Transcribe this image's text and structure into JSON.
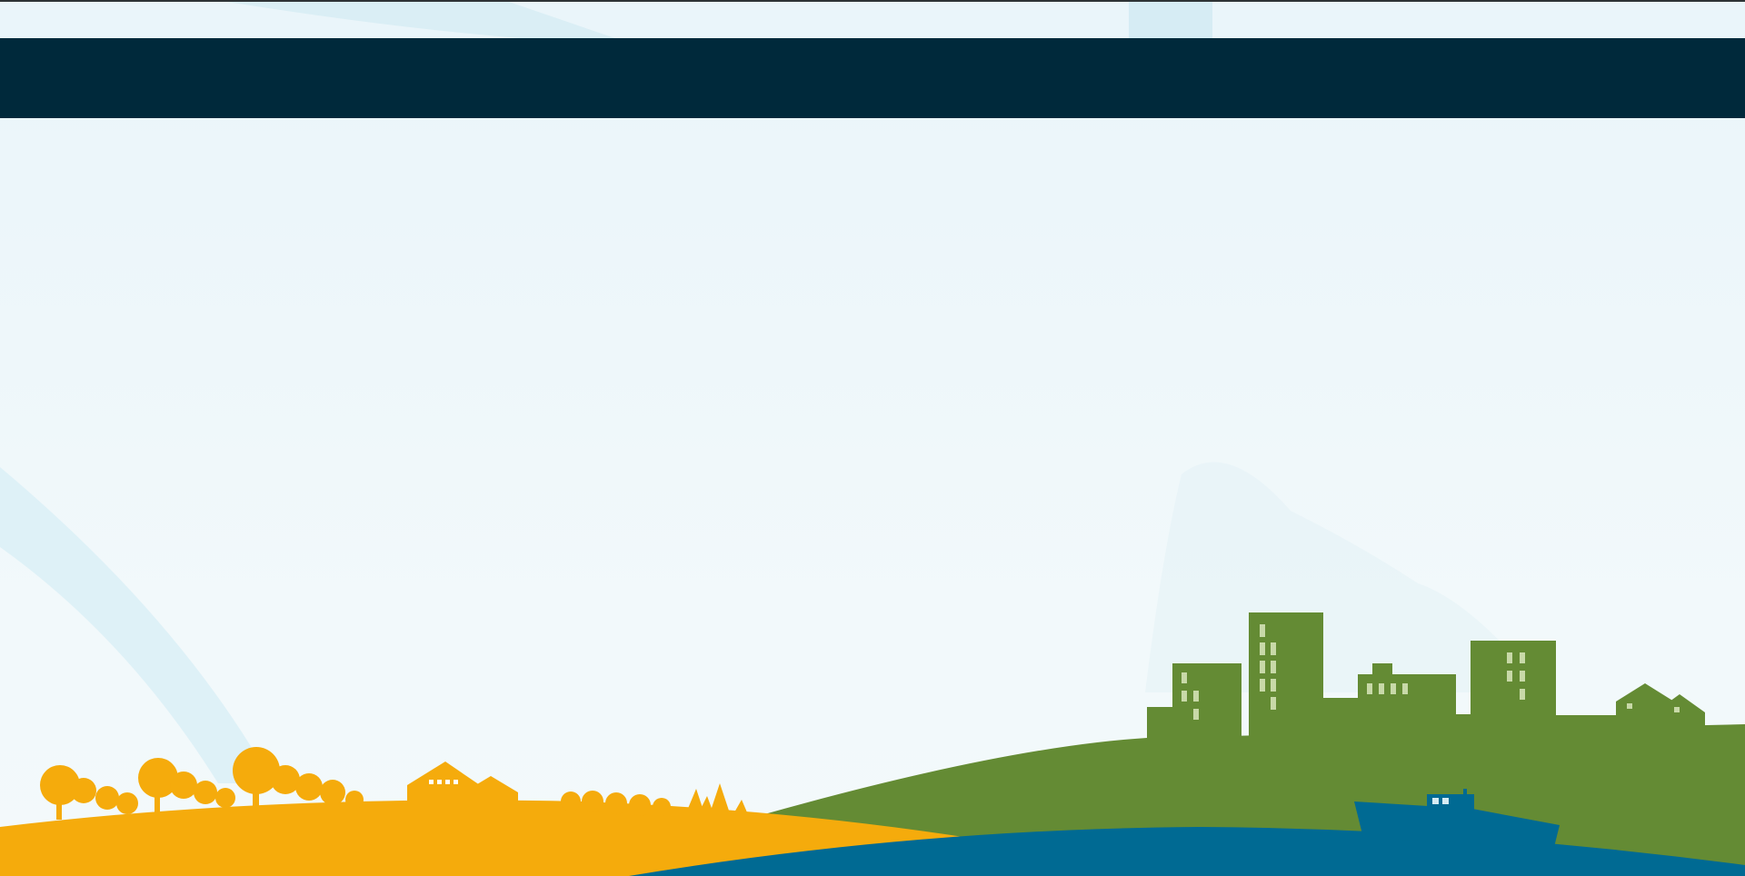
{
  "window": {
    "title": ""
  },
  "header": {
    "title": ""
  },
  "colors": {
    "header_bg": "#00293b",
    "sky": "#eef7fa",
    "field_yellow": "#f5ab0c",
    "hill_green": "#648b34",
    "water_blue": "#006a93",
    "building_window": "#c8d9a8"
  },
  "illustration": {
    "icons": [
      "trees-icon",
      "farmhouse-icon",
      "city-skyline-icon",
      "houses-icon",
      "boat-icon",
      "river-icon"
    ]
  }
}
